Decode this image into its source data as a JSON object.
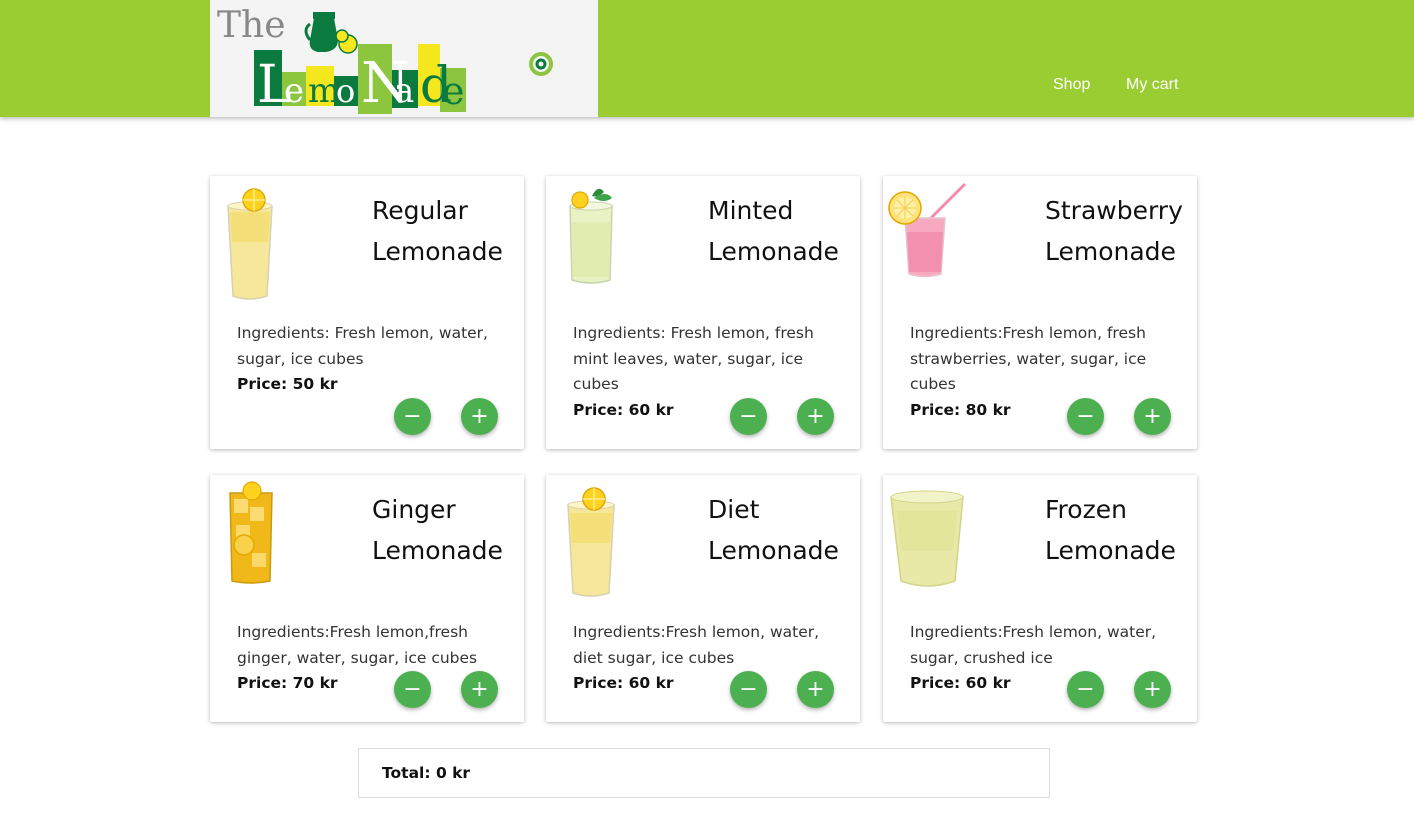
{
  "header": {
    "logo_the": "The",
    "logo_word": "LemoNade",
    "nav": [
      {
        "label": "Shop"
      },
      {
        "label": "My cart"
      }
    ],
    "colors": {
      "bar": "#9acd32",
      "logo_green": "#0b7a3e",
      "logo_lime": "#8cc63f",
      "logo_yellow": "#f4e71d"
    }
  },
  "products": [
    {
      "title": "Regular Lemonade",
      "ingredients": "Ingredients: Fresh lemon, water, sugar, ice cubes",
      "price": "Price: 50 kr",
      "image": "lemonade-glass-icon"
    },
    {
      "title": "Minted Lemonade",
      "ingredients": "Ingredients: Fresh lemon, fresh mint leaves, water, sugar, ice cubes",
      "price": "Price: 60 kr",
      "image": "mint-lemonade-glass-icon"
    },
    {
      "title": "Strawberry Lemonade",
      "ingredients": "Ingredients:Fresh lemon, fresh strawberries, water, sugar, ice cubes",
      "price": "Price: 80 kr",
      "image": "strawberry-lemonade-glass-icon"
    },
    {
      "title": "Ginger Lemonade",
      "ingredients": "Ingredients:Fresh lemon,fresh ginger, water, sugar, ice cubes",
      "price": "Price: 70 kr",
      "image": "ginger-lemonade-glass-icon"
    },
    {
      "title": "Diet Lemonade",
      "ingredients": "Ingredients:Fresh lemon, water, diet sugar, ice cubes",
      "price": "Price: 60 kr",
      "image": "diet-lemonade-glass-icon"
    },
    {
      "title": "Frozen Lemonade",
      "ingredients": "Ingredients:Fresh lemon, water, sugar, crushed ice",
      "price": "Price: 60 kr",
      "image": "frozen-lemonade-cup-icon"
    }
  ],
  "buttons": {
    "minus": "−",
    "plus": "+",
    "color": "#4caf50"
  },
  "total": "Total: 0 kr"
}
